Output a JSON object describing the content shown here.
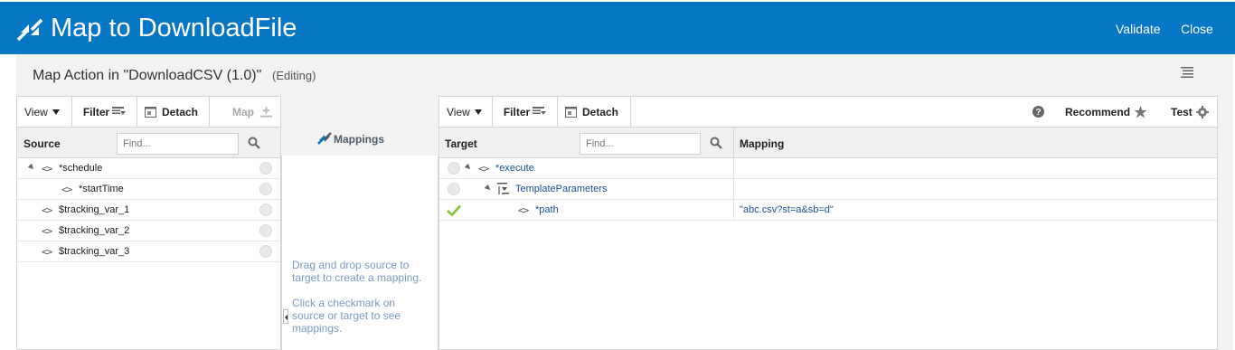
{
  "header": {
    "title": "Map to DownloadFile",
    "validate_label": "Validate",
    "close_label": "Close"
  },
  "subheader": {
    "title": "Map Action in \"DownloadCSV (1.0)\"",
    "status": "(Editing)"
  },
  "source_panel": {
    "toolbar": {
      "view_label": "View",
      "filter_label": "Filter",
      "detach_label": "Detach",
      "map_label": "Map"
    },
    "column_label": "Source",
    "find_placeholder": "Find...",
    "rows": [
      {
        "name": "*schedule"
      },
      {
        "name": "*startTime"
      },
      {
        "name": "$tracking_var_1"
      },
      {
        "name": "$tracking_var_2"
      },
      {
        "name": "$tracking_var_3"
      }
    ]
  },
  "mappings_panel": {
    "title": "Mappings",
    "hint1": [
      "Drag and drop source to",
      "target to create a mapping."
    ],
    "hint2": [
      "Click a checkmark on",
      "source or target to see",
      "mappings."
    ]
  },
  "target_panel": {
    "toolbar": {
      "view_label": "View",
      "filter_label": "Filter",
      "detach_label": "Detach",
      "recommend_label": "Recommend",
      "test_label": "Test"
    },
    "column_label": "Target",
    "mapping_label": "Mapping",
    "find_placeholder": "Find...",
    "rows": [
      {
        "name": "*execute",
        "mapping": ""
      },
      {
        "name": "TemplateParameters",
        "mapping": ""
      },
      {
        "name": "*path",
        "mapping": "\"abc.csv?st=a&sb=d\""
      }
    ]
  },
  "colors": {
    "header": "#0677c4",
    "node_text": "#1d4e91",
    "hint_text": "#7a9bbf",
    "check": "#8cc04a"
  }
}
